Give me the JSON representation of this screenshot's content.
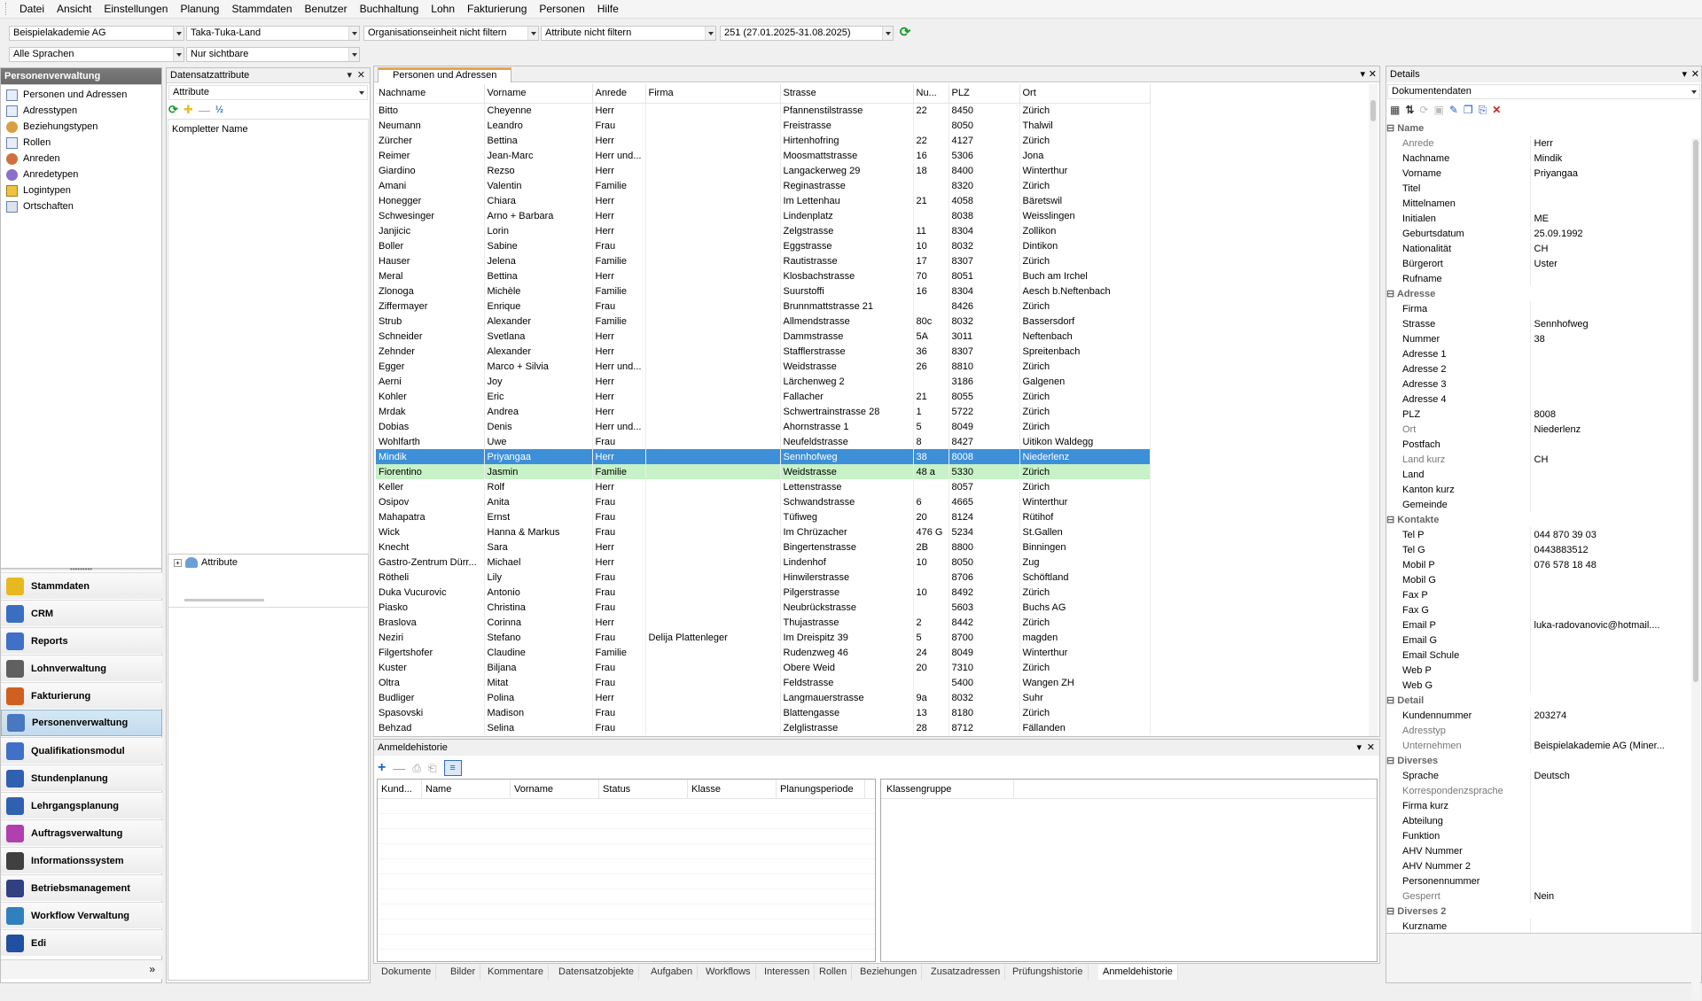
{
  "menu": [
    "Datei",
    "Ansicht",
    "Einstellungen",
    "Planung",
    "Stammdaten",
    "Benutzer",
    "Buchhaltung",
    "Lohn",
    "Fakturierung",
    "Personen",
    "Hilfe"
  ],
  "toolbar": {
    "company": "Beispielakademie AG",
    "region": "Taka-Tuka-Land",
    "org_unit": "Organisationseinheit nicht filtern",
    "attributes": "Attribute nicht filtern",
    "period": "251 (27.01.2025-31.08.2025)",
    "language": "Alle Sprachen",
    "visibility": "Nur sichtbare"
  },
  "left": {
    "title": "Personenverwaltung",
    "tree": [
      "Personen und Adressen",
      "Adresstypen",
      "Beziehungstypen",
      "Rollen",
      "Anreden",
      "Anredetypen",
      "Logintypen",
      "Ortschaften"
    ],
    "nav": [
      "Stammdaten",
      "CRM",
      "Reports",
      "Lohnverwaltung",
      "Fakturierung",
      "Personenverwaltung",
      "Qualifikationsmodul",
      "Stundenplanung",
      "Lehrgangsplanung",
      "Auftragsverwaltung",
      "Informationssystem",
      "Betriebsmanagement",
      "Workflow Verwaltung",
      "Edi"
    ],
    "active_nav": "Personenverwaltung"
  },
  "attr_panel": {
    "title": "Datensatzattribute",
    "selector": "Attribute",
    "field": "Kompletter Name",
    "tree_root": "Attribute"
  },
  "main": {
    "tab": "Personen und Adressen",
    "columns": [
      "Nachname",
      "Vorname",
      "Anrede",
      "Firma",
      "Strasse",
      "Nu...",
      "PLZ",
      "Ort"
    ],
    "rows": [
      [
        "Bitto",
        "Cheyenne",
        "Herr",
        "",
        "Pfannenstilstrasse",
        "22",
        "8450",
        "Zürich"
      ],
      [
        "Neumann",
        "Leandro",
        "Frau",
        "",
        "Freistrasse",
        "",
        "8050",
        "Thalwil"
      ],
      [
        "Zürcher",
        "Bettina",
        "Herr",
        "",
        "Hirtenhofring",
        "22",
        "4127",
        "Zürich"
      ],
      [
        "Reimer",
        "Jean-Marc",
        "Herr und...",
        "",
        "Moosmattstrasse",
        "16",
        "5306",
        "Jona"
      ],
      [
        "Giardino",
        "Rezso",
        "Herr",
        "",
        "Langackerweg 29",
        "18",
        "8400",
        "Winterthur"
      ],
      [
        "Amani",
        "Valentin",
        "Familie",
        "",
        "Reginastrasse",
        "",
        "8320",
        "Zürich"
      ],
      [
        "Honegger",
        "Chiara",
        "Herr",
        "",
        "Im Lettenhau",
        "21",
        "4058",
        "Bäretswil"
      ],
      [
        "Schwesinger",
        "Arno + Barbara",
        "Herr",
        "",
        "Lindenplatz",
        "",
        "8038",
        "Weisslingen"
      ],
      [
        "Janjicic",
        "Lorin",
        "Herr",
        "",
        "Zelgstrasse",
        "11",
        "8304",
        "Zollikon"
      ],
      [
        "Boller",
        "Sabine",
        "Frau",
        "",
        "Eggstrasse",
        "10",
        "8032",
        "Dintikon"
      ],
      [
        "Hauser",
        "Jelena",
        "Familie",
        "",
        "Rautistrasse",
        "17",
        "8307",
        "Zürich"
      ],
      [
        "Meral",
        "Bettina",
        "Herr",
        "",
        "Klosbachstrasse",
        "70",
        "8051",
        "Buch am Irchel"
      ],
      [
        "Zlonoga",
        "Michèle",
        "Familie",
        "",
        "Suurstoffi",
        "16",
        "8304",
        "Aesch b.Neftenbach"
      ],
      [
        "Ziffermayer",
        "Enrique",
        "Frau",
        "",
        "Brunnmattstrasse 21",
        "",
        "8426",
        "Zürich"
      ],
      [
        "Strub",
        "Alexander",
        "Familie",
        "",
        "Allmendstrasse",
        "80c",
        "8032",
        "Bassersdorf"
      ],
      [
        "Schneider",
        "Svetlana",
        "Herr",
        "",
        "Dammstrasse",
        "5A",
        "3011",
        "Neftenbach"
      ],
      [
        "Zehnder",
        "Alexander",
        "Herr",
        "",
        "Stafflerstrasse",
        "36",
        "8307",
        "Spreitenbach"
      ],
      [
        "Egger",
        "Marco + Silvia",
        "Herr und...",
        "",
        "Weidstrasse",
        "26",
        "8810",
        "Zürich"
      ],
      [
        "Aerni",
        "Joy",
        "Herr",
        "",
        "Lärchenweg 2",
        "",
        "3186",
        "Galgenen"
      ],
      [
        "Kohler",
        "Eric",
        "Herr",
        "",
        "Fallacher",
        "21",
        "8055",
        "Zürich"
      ],
      [
        "Mrdak",
        "Andrea",
        "Herr",
        "",
        "Schwertrainstrasse 28",
        "1",
        "5722",
        "Zürich"
      ],
      [
        "Dobias",
        "Denis",
        "Herr und...",
        "",
        "Ahornstrasse 1",
        "5",
        "8049",
        "Zürich"
      ],
      [
        "Wohlfarth",
        "Uwe",
        "Frau",
        "",
        "Neufeldstrasse",
        "8",
        "8427",
        "Uitikon Waldegg"
      ],
      [
        "Mindik",
        "Priyangaa",
        "Herr",
        "",
        "Sennhofweg",
        "38",
        "8008",
        "Niederlenz"
      ],
      [
        "Fiorentino",
        "Jasmin",
        "Familie",
        "",
        "Weidstrasse",
        "48 a",
        "5330",
        "Zürich"
      ],
      [
        "Keller",
        "Rolf",
        "Herr",
        "",
        "Lettenstrasse",
        "",
        "8057",
        "Zürich"
      ],
      [
        "Osipov",
        "Anita",
        "Frau",
        "",
        "Schwandstrasse",
        "6",
        "4665",
        "Winterthur"
      ],
      [
        "Mahapatra",
        "Ernst",
        "Frau",
        "",
        "Tüfiweg",
        "20",
        "8124",
        "Rütihof"
      ],
      [
        "Wick",
        "Hanna & Markus",
        "Frau",
        "",
        "Im Chrüzacher",
        "476 G",
        "5234",
        "St.Gallen"
      ],
      [
        "Knecht",
        "Sara",
        "Herr",
        "",
        "Bingertenstrasse",
        "2B",
        "8800",
        "Binningen"
      ],
      [
        "Gastro-Zentrum Dürr...",
        "Michael",
        "Herr",
        "",
        "Lindenhof",
        "10",
        "8050",
        "Zug"
      ],
      [
        "Rötheli",
        "Lily",
        "Frau",
        "",
        "Hinwilerstrasse",
        "",
        "8706",
        "Schöftland"
      ],
      [
        "Duka Vucurovic",
        "Antonio",
        "Frau",
        "",
        "Pilgerstrasse",
        "10",
        "8492",
        "Zürich"
      ],
      [
        "Piasko",
        "Christina",
        "Frau",
        "",
        "Neubrückstrasse",
        "",
        "5603",
        "Buchs AG"
      ],
      [
        "Braslova",
        "Corinna",
        "Herr",
        "",
        "Thujastrasse",
        "2",
        "8442",
        "Zürich"
      ],
      [
        "Neziri",
        "Stefano",
        "Frau",
        "Delija Plattenleger",
        "Im Dreispitz 39",
        "5",
        "8700",
        "magden"
      ],
      [
        "Filgertshofer",
        "Claudine",
        "Familie",
        "",
        "Rudenzweg 46",
        "24",
        "8049",
        "Winterthur"
      ],
      [
        "Kuster",
        "Biljana",
        "Frau",
        "",
        "Obere Weid",
        "20",
        "7310",
        "Zürich"
      ],
      [
        "Oltra",
        "Mitat",
        "Frau",
        "",
        "Feldstrasse",
        "",
        "5400",
        "Wangen ZH"
      ],
      [
        "Budliger",
        "Polina",
        "Herr",
        "",
        "Langmauerstrasse",
        "9a",
        "8032",
        "Suhr"
      ],
      [
        "Spasovski",
        "Madison",
        "Frau",
        "",
        "Blattengasse",
        "13",
        "8180",
        "Zürich"
      ],
      [
        "Behzad",
        "Selina",
        "Frau",
        "",
        "Zelglistrasse",
        "28",
        "8712",
        "Fällanden"
      ]
    ],
    "selected_index": 23,
    "highlight_index": 24
  },
  "history": {
    "title": "Anmeldehistorie",
    "columns": [
      "Kund...",
      "Name",
      "Vorname",
      "Status",
      "Klasse",
      "Planungsperiode"
    ],
    "right_columns": [
      "Klassengruppe"
    ]
  },
  "bottom_tabs": [
    "Dokumente",
    "Bilder",
    "Kommentare",
    "Datensatzobjekte",
    "Aufgaben",
    "Workflows",
    "Interessen",
    "Rollen",
    "Beziehungen",
    "Zusatzadressen",
    "Prüfungshistorie",
    "Anmeldehistorie"
  ],
  "details": {
    "title": "Details",
    "selector": "Dokumentendaten",
    "rows": [
      {
        "s": "Name"
      },
      {
        "k": "Anrede",
        "v": "Herr",
        "dim": true
      },
      {
        "k": "Nachname",
        "v": "Mindik"
      },
      {
        "k": "Vorname",
        "v": "Priyangaa"
      },
      {
        "k": "Titel",
        "v": ""
      },
      {
        "k": "Mittelnamen",
        "v": ""
      },
      {
        "k": "Initialen",
        "v": "ME"
      },
      {
        "k": "Geburtsdatum",
        "v": "25.09.1992"
      },
      {
        "k": "Nationalität",
        "v": "CH"
      },
      {
        "k": "Bürgerort",
        "v": "Uster"
      },
      {
        "k": "Rufname",
        "v": ""
      },
      {
        "s": "Adresse"
      },
      {
        "k": "Firma",
        "v": ""
      },
      {
        "k": "Strasse",
        "v": "Sennhofweg"
      },
      {
        "k": "Nummer",
        "v": "38"
      },
      {
        "k": "Adresse 1",
        "v": ""
      },
      {
        "k": "Adresse 2",
        "v": ""
      },
      {
        "k": "Adresse 3",
        "v": ""
      },
      {
        "k": "Adresse 4",
        "v": ""
      },
      {
        "k": "PLZ",
        "v": "8008"
      },
      {
        "k": "Ort",
        "v": "Niederlenz",
        "dim": true
      },
      {
        "k": "Postfach",
        "v": ""
      },
      {
        "k": "Land kurz",
        "v": "CH",
        "dim": true
      },
      {
        "k": "Land",
        "v": ""
      },
      {
        "k": "Kanton kurz",
        "v": ""
      },
      {
        "k": "Gemeinde",
        "v": ""
      },
      {
        "s": "Kontakte"
      },
      {
        "k": "Tel P",
        "v": "044 870 39 03"
      },
      {
        "k": "Tel G",
        "v": "0443883512"
      },
      {
        "k": "Mobil P",
        "v": "076   578 18 48"
      },
      {
        "k": "Mobil G",
        "v": ""
      },
      {
        "k": "Fax P",
        "v": ""
      },
      {
        "k": "Fax G",
        "v": ""
      },
      {
        "k": "Email P",
        "v": "luka-radovanovic@hotmail...."
      },
      {
        "k": "Email G",
        "v": ""
      },
      {
        "k": "Email Schule",
        "v": ""
      },
      {
        "k": "Web P",
        "v": ""
      },
      {
        "k": "Web G",
        "v": ""
      },
      {
        "s": "Detail"
      },
      {
        "k": "Kundennummer",
        "v": "203274"
      },
      {
        "k": "Adresstyp",
        "v": "",
        "dim": true
      },
      {
        "k": "Unternehmen",
        "v": "Beispielakademie AG (Miner...",
        "dim": true
      },
      {
        "s": "Diverses"
      },
      {
        "k": "Sprache",
        "v": "Deutsch"
      },
      {
        "k": "Korrespondenzsprache",
        "v": "",
        "dim": true
      },
      {
        "k": "Firma kurz",
        "v": ""
      },
      {
        "k": "Abteilung",
        "v": ""
      },
      {
        "k": "Funktion",
        "v": ""
      },
      {
        "k": "AHV Nummer",
        "v": ""
      },
      {
        "k": "AHV Nummer 2",
        "v": ""
      },
      {
        "k": "Personennummer",
        "v": ""
      },
      {
        "k": "Gesperrt",
        "v": "Nein",
        "dim": true
      },
      {
        "s": "Diverses 2"
      },
      {
        "k": "Kurzname",
        "v": ""
      }
    ]
  },
  "colors": {
    "selection": "#3d8fd8",
    "highlight": "#c7f2c7",
    "accent_red": "#d02020"
  }
}
